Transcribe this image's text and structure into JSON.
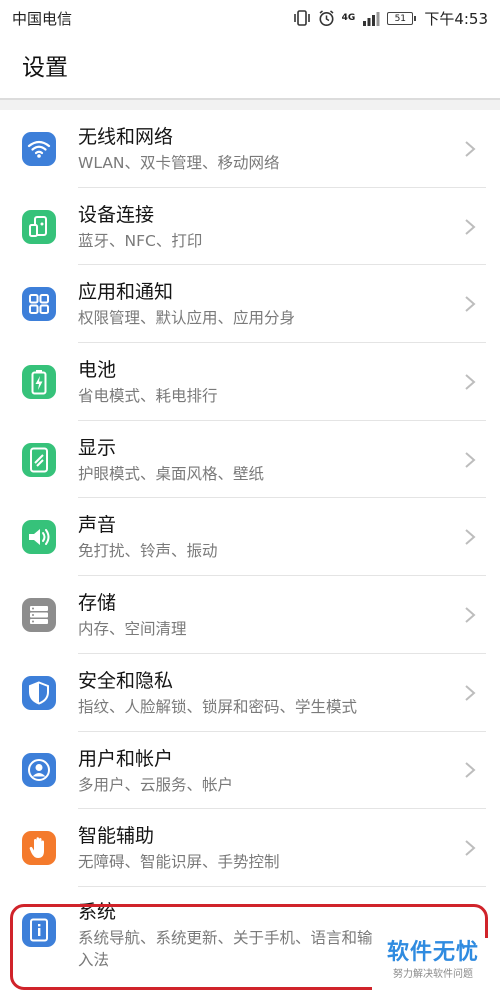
{
  "status_bar": {
    "carrier": "中国电信",
    "network": "4G",
    "battery": "51",
    "time": "下午4:53"
  },
  "header": {
    "title": "设置"
  },
  "colors": {
    "blue": "#3d7fd9",
    "green": "#36c27a",
    "gray": "#8d8d8d",
    "orange": "#f47a2c",
    "highlight": "#d0232a",
    "watermark": "#2f8be0"
  },
  "items": [
    {
      "title": "无线和网络",
      "subtitle": "WLAN、双卡管理、移动网络",
      "icon": "wifi-icon"
    },
    {
      "title": "设备连接",
      "subtitle": "蓝牙、NFC、打印",
      "icon": "device-connection-icon"
    },
    {
      "title": "应用和通知",
      "subtitle": "权限管理、默认应用、应用分身",
      "icon": "apps-grid-icon"
    },
    {
      "title": "电池",
      "subtitle": "省电模式、耗电排行",
      "icon": "battery-icon"
    },
    {
      "title": "显示",
      "subtitle": "护眼模式、桌面风格、壁纸",
      "icon": "display-icon"
    },
    {
      "title": "声音",
      "subtitle": "免打扰、铃声、振动",
      "icon": "speaker-icon"
    },
    {
      "title": "存储",
      "subtitle": "内存、空间清理",
      "icon": "storage-icon"
    },
    {
      "title": "安全和隐私",
      "subtitle": "指纹、人脸解锁、锁屏和密码、学生模式",
      "icon": "shield-icon"
    },
    {
      "title": "用户和帐户",
      "subtitle": "多用户、云服务、帐户",
      "icon": "user-icon"
    },
    {
      "title": "智能辅助",
      "subtitle": "无障碍、智能识屏、手势控制",
      "icon": "hand-icon"
    },
    {
      "title": "系统",
      "subtitle": "系统导航、系统更新、关于手机、语言和输入法",
      "icon": "system-info-icon"
    }
  ],
  "watermark": {
    "name": "软件无忧",
    "tagline": "努力解决软件问题"
  }
}
